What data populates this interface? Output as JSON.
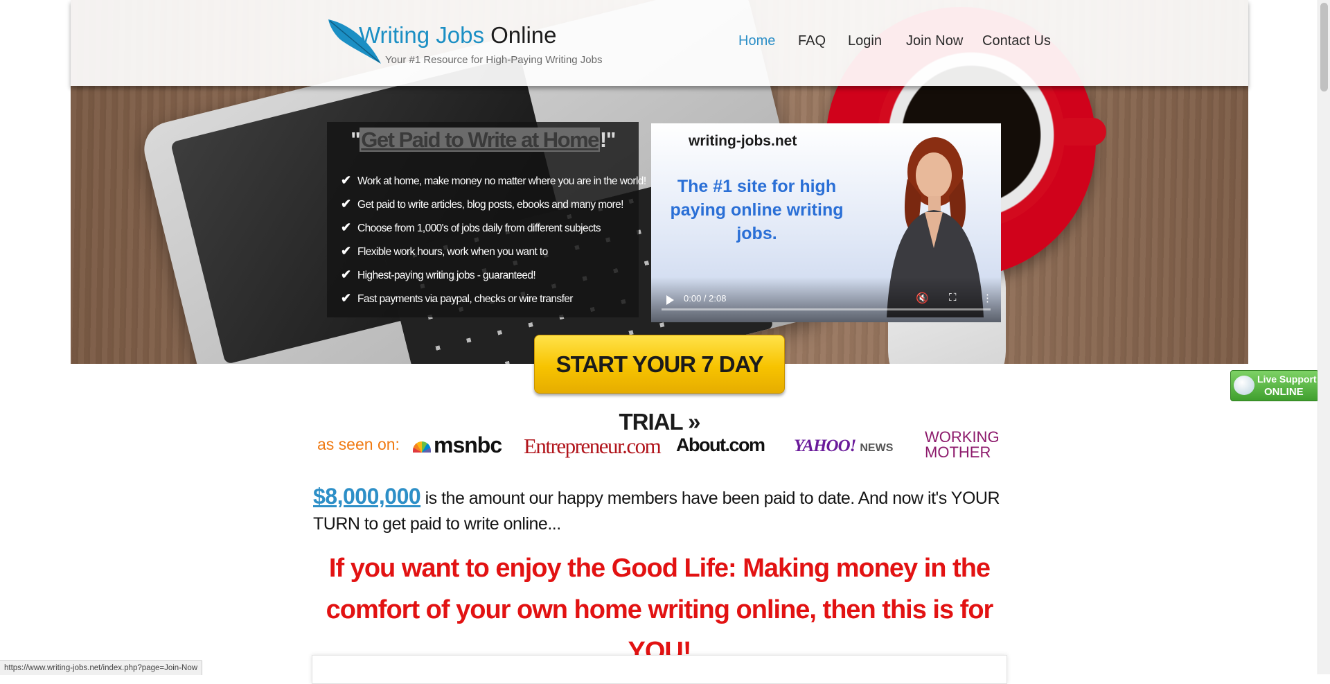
{
  "header": {
    "logo": {
      "title_part1": "Writing Jobs",
      "title_part2": "Online",
      "tagline": "Your #1 Resource for High-Paying Writing Jobs"
    },
    "nav": [
      {
        "label": "Home",
        "active": true
      },
      {
        "label": "FAQ",
        "active": false
      },
      {
        "label": "Login",
        "active": false
      },
      {
        "label": "Join Now",
        "active": false
      },
      {
        "label": "Contact Us",
        "active": false
      }
    ]
  },
  "hero": {
    "headline_open": "\"",
    "headline": "Get Paid to Write at Home",
    "headline_close": "!\"",
    "features": [
      "Work at home, make money no matter where you are in the world!",
      "Get paid to write articles, blog posts, ebooks and many more!",
      "Choose from 1,000's of jobs daily from different subjects",
      "Flexible work hours, work when you want to",
      "Highest-paying writing jobs - guaranteed!",
      "Fast payments via paypal, checks or wire transfer"
    ],
    "video": {
      "site": "writing-jobs.net",
      "pitch": "The #1 site for high paying online writing jobs.",
      "time": "0:00 / 2:08",
      "progress": 0
    },
    "cta_label": "START YOUR 7 DAY TRIAL »"
  },
  "live_support": {
    "line1": "Live Support",
    "line2": "ONLINE"
  },
  "as_seen_on": {
    "label": "as seen on:",
    "media": [
      "msnbc",
      "Entrepreneur.com",
      "About.com",
      "YAHOO!",
      "NEWS",
      "WORKING",
      "MOTHER"
    ]
  },
  "main": {
    "amount": "$8,000,000",
    "amount_text": " is the amount our happy members have been paid to date. And now it's YOUR TURN to get paid to write online...",
    "good_life": "If you want to enjoy the Good Life: Making money in the comfort of your own home writing online, then this is for YOU!"
  },
  "status_bar": {
    "url": "https://www.writing-jobs.net/index.php?page=Join-Now"
  },
  "colors": {
    "accent": "#2d8fc7",
    "cta": "#f7c300",
    "headline_red": "#e21212",
    "live": "#4fae3b"
  }
}
